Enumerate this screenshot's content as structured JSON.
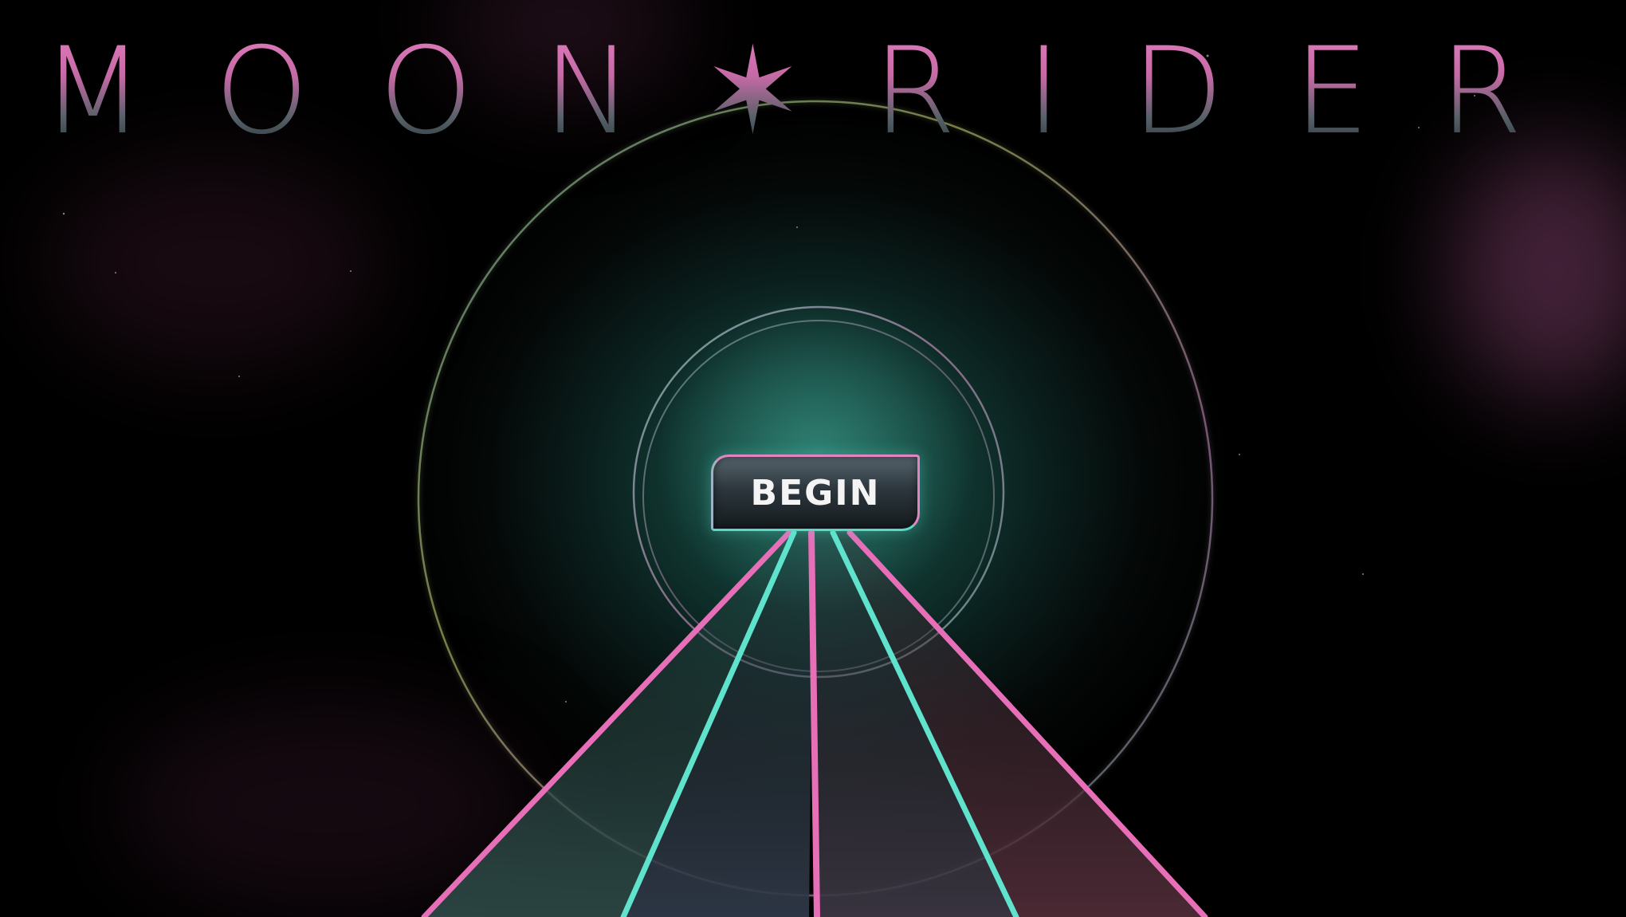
{
  "title": "MOON✶RIDER",
  "menu": {
    "begin_label": "BEGIN"
  },
  "colors": {
    "lane_pink": "#e76fb8",
    "lane_cyan": "#5fe3cd",
    "glow_teal": "#1d5a50",
    "background": "#000000"
  },
  "icons": {
    "title_star": "six-pointed-star-icon"
  }
}
